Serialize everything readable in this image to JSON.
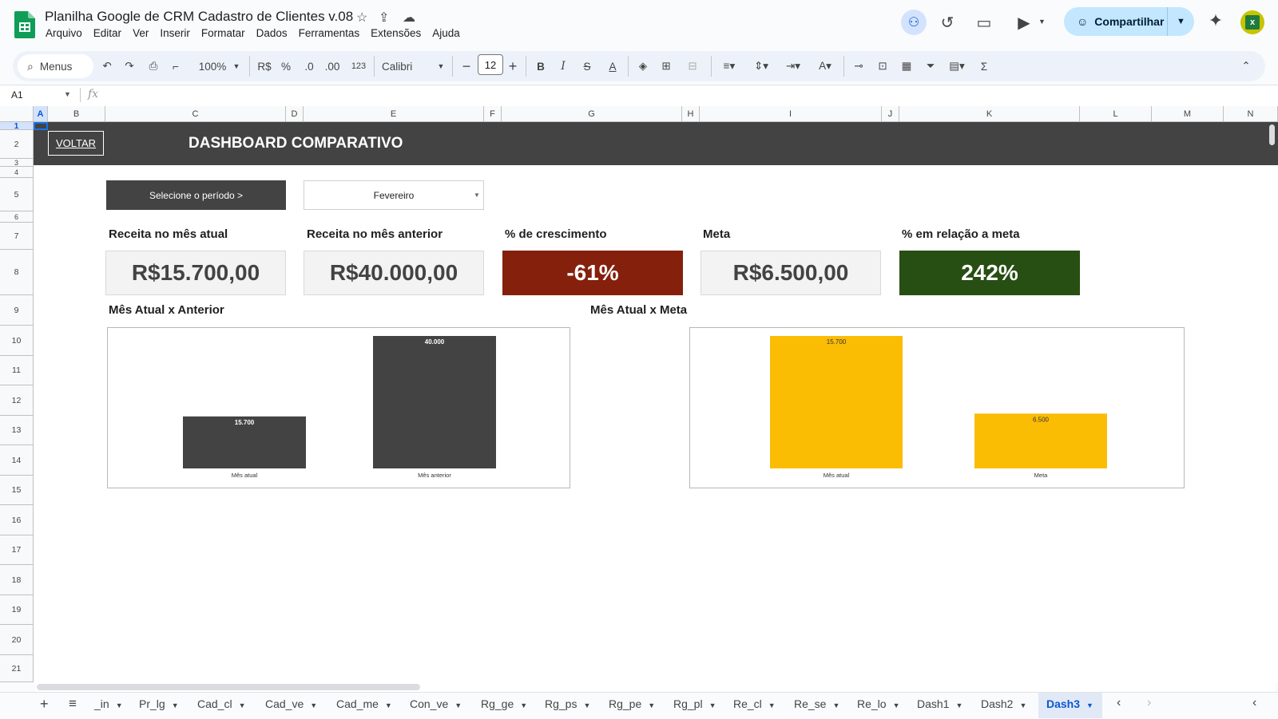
{
  "app": {
    "doc_title": "Planilha Google de CRM Cadastro de Clientes v.08",
    "menu": [
      "Arquivo",
      "Editar",
      "Ver",
      "Inserir",
      "Formatar",
      "Dados",
      "Ferramentas",
      "Extensões",
      "Ajuda"
    ],
    "share_label": "Compartilhar"
  },
  "toolbar": {
    "search_label": "Menus",
    "zoom": "100%",
    "currency": "R$",
    "percent": "%",
    "dec_decrease": ".0",
    "dec_increase": ".00",
    "number_format": "123",
    "font": "Calibri",
    "font_size": "12"
  },
  "formula_bar": {
    "cell_ref": "A1",
    "fx": "fx"
  },
  "columns": [
    "A",
    "B",
    "C",
    "D",
    "E",
    "F",
    "G",
    "H",
    "I",
    "J",
    "K",
    "L",
    "M",
    "N"
  ],
  "rows": [
    "1",
    "2",
    "3",
    "4",
    "5",
    "6",
    "7",
    "8",
    "9",
    "10",
    "11",
    "12",
    "13",
    "14",
    "15",
    "16",
    "17",
    "18",
    "19",
    "20",
    "21"
  ],
  "sheet": {
    "back_button": "VOLTAR",
    "title": "DASHBOARD COMPARATIVO",
    "period_label": "Selecione o período >",
    "period_value": "Fevereiro",
    "kpis": [
      {
        "label": "Receita no mês atual",
        "value": "R$15.700,00",
        "color": "#f3f3f3"
      },
      {
        "label": "Receita no mês anterior",
        "value": "R$40.000,00",
        "color": "#f3f3f3"
      },
      {
        "label": "% de crescimento",
        "value": "-61%",
        "color": "#85200c"
      },
      {
        "label": "Meta",
        "value": "R$6.500,00",
        "color": "#f3f3f3"
      },
      {
        "label": "% em relação a meta",
        "value": "242%",
        "color": "#274e13"
      }
    ]
  },
  "chart_data": [
    {
      "type": "bar",
      "title": "Mês Atual x Anterior",
      "categories": [
        "Mês atual",
        "Mês anterior"
      ],
      "values": [
        15700,
        40000
      ],
      "value_labels": [
        "15.700",
        "40.000"
      ],
      "ylim": [
        0,
        40000
      ],
      "color": "#434343",
      "grid": false,
      "legend": "none"
    },
    {
      "type": "bar",
      "title": "Mês Atual x Meta",
      "categories": [
        "Mês atual",
        "Meta"
      ],
      "values": [
        15700,
        6500
      ],
      "value_labels": [
        "15.700",
        "6.500"
      ],
      "ylim": [
        0,
        15700
      ],
      "color": "#fbbc04",
      "grid": false,
      "legend": "none"
    }
  ],
  "sheet_tabs": [
    "_in",
    "Pr_lg",
    "Cad_cl",
    "Cad_ve",
    "Cad_me",
    "Con_ve",
    "Rg_ge",
    "Rg_ps",
    "Rg_pe",
    "Rg_pl",
    "Re_cl",
    "Re_se",
    "Re_lo",
    "Dash1",
    "Dash2",
    "Dash3"
  ],
  "active_tab": "Dash3"
}
